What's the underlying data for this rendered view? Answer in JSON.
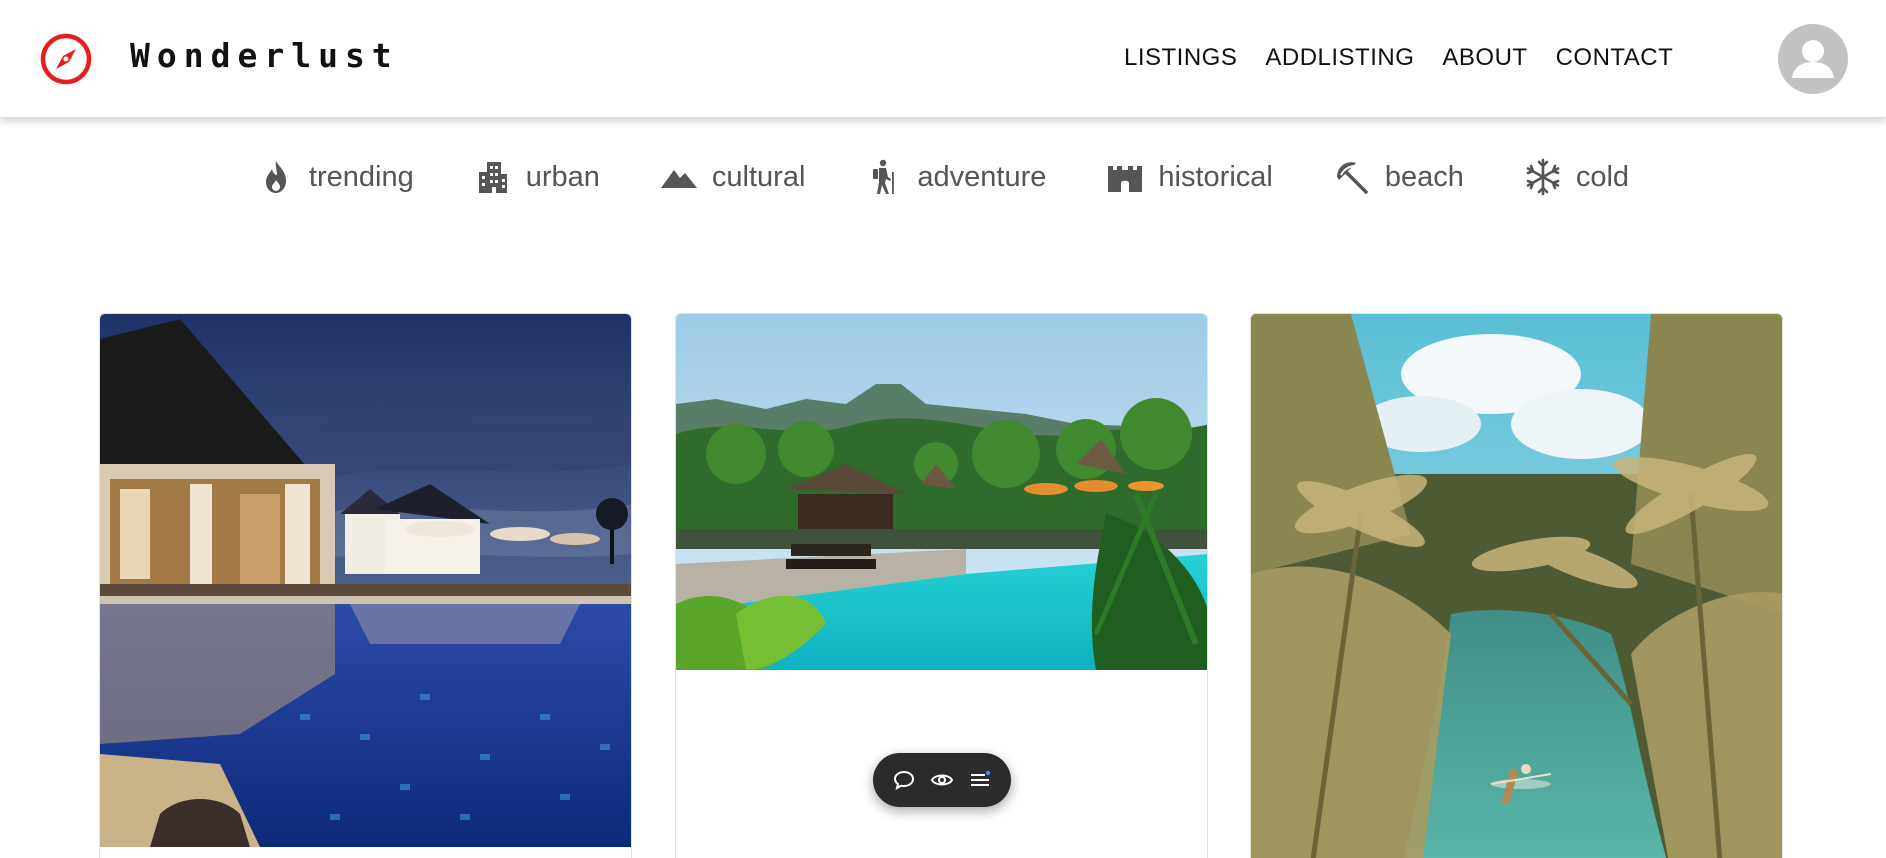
{
  "brand": {
    "name": "Wonderlust",
    "icon": "compass-icon",
    "accent_color": "#e61e1e"
  },
  "nav": {
    "links": [
      {
        "label": "LISTINGS"
      },
      {
        "label": "ADDLISTING"
      },
      {
        "label": "ABOUT"
      },
      {
        "label": "CONTACT"
      }
    ],
    "avatar_icon": "user-avatar-icon"
  },
  "filters": [
    {
      "label": "trending",
      "icon": "fire-icon"
    },
    {
      "label": "urban",
      "icon": "building-icon"
    },
    {
      "label": "cultural",
      "icon": "mountain-icon"
    },
    {
      "label": "adventure",
      "icon": "hiker-icon"
    },
    {
      "label": "historical",
      "icon": "castle-icon"
    },
    {
      "label": "beach",
      "icon": "umbrella-beach-icon"
    },
    {
      "label": "cold",
      "icon": "snowflake-icon"
    }
  ],
  "listings": [
    {
      "photo": "resort-pool-at-dusk-photo"
    },
    {
      "photo": "tropical-pool-with-huts-photo"
    },
    {
      "photo": "palm-river-canoe-photo"
    }
  ],
  "toolbar": {
    "buttons": [
      {
        "icon": "comment-icon"
      },
      {
        "icon": "eye-icon"
      },
      {
        "icon": "menu-icon"
      }
    ]
  }
}
